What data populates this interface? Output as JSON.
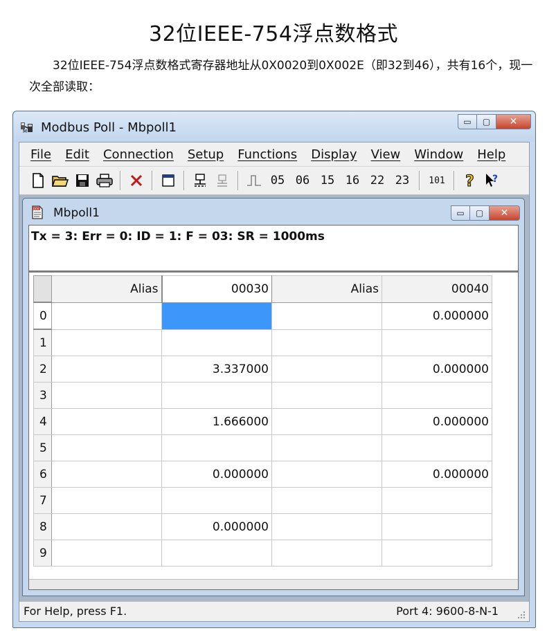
{
  "page": {
    "title": "32位IEEE-754浮点数格式",
    "intro": "32位IEEE-754浮点数格式寄存器地址从0X0020到0X002E（即32到46），共有16个，现一次全部读取："
  },
  "window": {
    "title": "Modbus Poll - Mbpoll1",
    "menu": [
      "File",
      "Edit",
      "Connection",
      "Setup",
      "Functions",
      "Display",
      "View",
      "Window",
      "Help"
    ],
    "toolbar_codes": [
      "05",
      "06",
      "15",
      "16",
      "22",
      "23",
      "101"
    ],
    "caption_glyphs": {
      "minimize": "▭",
      "maximize": "▢",
      "close": "✕"
    }
  },
  "child": {
    "title": "Mbpoll1",
    "status_line": "Tx = 3: Err = 0: ID = 1: F = 03: SR = 1000ms",
    "columns": [
      "Alias",
      "00030",
      "Alias",
      "00040"
    ],
    "rows": [
      {
        "idx": "0",
        "c1": "",
        "c2": "",
        "c3": "",
        "c4": "0.000000"
      },
      {
        "idx": "1",
        "c1": "",
        "c2": "",
        "c3": "",
        "c4": ""
      },
      {
        "idx": "2",
        "c1": "",
        "c2": "3.337000",
        "c3": "",
        "c4": "0.000000"
      },
      {
        "idx": "3",
        "c1": "",
        "c2": "",
        "c3": "",
        "c4": ""
      },
      {
        "idx": "4",
        "c1": "",
        "c2": "1.666000",
        "c3": "",
        "c4": "0.000000"
      },
      {
        "idx": "5",
        "c1": "",
        "c2": "",
        "c3": "",
        "c4": ""
      },
      {
        "idx": "6",
        "c1": "",
        "c2": "0.000000",
        "c3": "",
        "c4": "0.000000"
      },
      {
        "idx": "7",
        "c1": "",
        "c2": "",
        "c3": "",
        "c4": ""
      },
      {
        "idx": "8",
        "c1": "",
        "c2": "0.000000",
        "c3": "",
        "c4": ""
      },
      {
        "idx": "9",
        "c1": "",
        "c2": "",
        "c3": "",
        "c4": ""
      }
    ],
    "selected_row": "0",
    "selected_column": "00030",
    "selection_color": "#3d97fa"
  },
  "statusbar": {
    "help": "For Help, press F1.",
    "port": "Port 4: 9600-8-N-1"
  }
}
